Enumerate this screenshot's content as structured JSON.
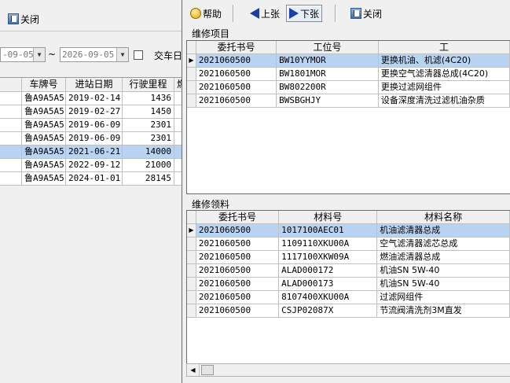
{
  "background": {
    "toolbar": {
      "close_label": "关闭"
    },
    "filter": {
      "date_from": "-09-05",
      "date_to": "2026-09-05",
      "separator": "~",
      "label": "交车日"
    },
    "grid": {
      "columns": [
        "",
        "车牌号",
        "进站日期",
        "行驶里程",
        "燃"
      ],
      "rows": [
        {
          "plate": "鲁A9A5A5",
          "date": "2019-02-14",
          "mileage": "1436"
        },
        {
          "plate": "鲁A9A5A5",
          "date": "2019-02-27",
          "mileage": "1450"
        },
        {
          "plate": "鲁A9A5A5",
          "date": "2019-06-09",
          "mileage": "2301"
        },
        {
          "plate": "鲁A9A5A5",
          "date": "2019-06-09",
          "mileage": "2301"
        },
        {
          "plate": "鲁A9A5A5",
          "date": "2021-06-21",
          "mileage": "14000"
        },
        {
          "plate": "鲁A9A5A5",
          "date": "2022-09-12",
          "mileage": "21000"
        },
        {
          "plate": "鲁A9A5A5",
          "date": "2024-01-01",
          "mileage": "28145"
        }
      ]
    }
  },
  "dialog": {
    "toolbar": {
      "help_label": "帮助",
      "prev_label": "上张",
      "next_label": "下张",
      "close_label": "关闭"
    },
    "repair_items": {
      "title": "维修项目",
      "columns": [
        "委托书号",
        "工位号",
        "工"
      ],
      "rows": [
        {
          "order": "2021060500",
          "code": "BW10YYMOR",
          "name": "更换机油、机滤(4C20)"
        },
        {
          "order": "2021060500",
          "code": "BW1801MOR",
          "name": "更换空气滤清器总成(4C20)"
        },
        {
          "order": "2021060500",
          "code": "BW802200R",
          "name": "更换过滤网组件"
        },
        {
          "order": "2021060500",
          "code": "BWSBGHJY",
          "name": "设备深度清洗过滤机油杂质"
        }
      ]
    },
    "repair_materials": {
      "title": "维修领料",
      "columns": [
        "委托书号",
        "材料号",
        "材料名称"
      ],
      "rows": [
        {
          "order": "2021060500",
          "code": "1017100AEC01",
          "name": "机油滤清器总成"
        },
        {
          "order": "2021060500",
          "code": "1109110XKU00A",
          "name": "空气滤清器滤芯总成"
        },
        {
          "order": "2021060500",
          "code": "1117100XKW09A",
          "name": "燃油滤清器总成"
        },
        {
          "order": "2021060500",
          "code": "ALAD000172",
          "name": "机油SN 5W-40"
        },
        {
          "order": "2021060500",
          "code": "ALAD000173",
          "name": "机油SN 5W-40"
        },
        {
          "order": "2021060500",
          "code": "8107400XKU00A",
          "name": "过滤网组件"
        },
        {
          "order": "2021060500",
          "code": "CSJP02087X",
          "name": "节流阀清洗剂3M直发"
        }
      ]
    }
  },
  "colors": {
    "selection": "#b9d3f3",
    "arrow_icon": "#1a3fa8"
  },
  "icons": [
    "close-icon",
    "help-icon",
    "arrow-left-icon",
    "arrow-right-icon",
    "row-pointer-icon"
  ]
}
